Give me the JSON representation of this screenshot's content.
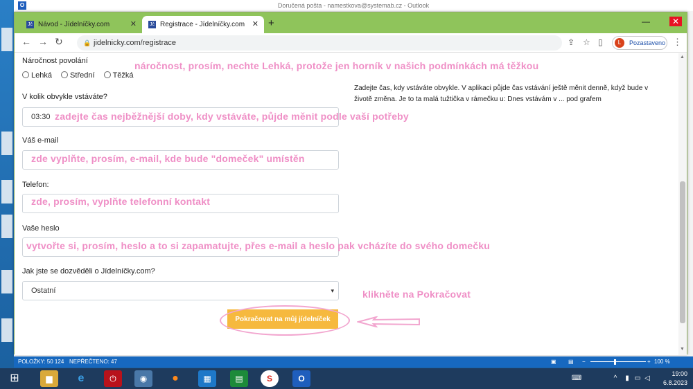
{
  "outlook": {
    "title": "Doručená pošta - namestkova@systemab.cz - Outlook",
    "status_items": "POLOŽKY: 50 124",
    "status_unread": "NEPŘEČTENO: 47",
    "zoom": "100 %"
  },
  "browser": {
    "tabs": [
      {
        "label": "Návod - Jídelníčky.com"
      },
      {
        "label": "Registrace - Jídelníčky.com"
      }
    ],
    "url": "jidelnicky.com/registrace",
    "profile_label": "Pozastaveno",
    "profile_initial": "L"
  },
  "form": {
    "difficulty_label": "Náročnost povolání",
    "difficulty_options": [
      "Lehká",
      "Střední",
      "Těžká"
    ],
    "wake_label": "V kolik obvykle vstáváte?",
    "wake_value": "03:30",
    "email_label": "Váš e-mail",
    "phone_label": "Telefon:",
    "password_label": "Vaše heslo",
    "source_label": "Jak jste se dozvěděli o Jídelníčky.com?",
    "source_value": "Ostatní",
    "submit_label": "Pokračovat na můj jídelníček"
  },
  "help_text": "Zadejte čas, kdy vstáváte obvykle. V aplikaci půjde čas vstávání ještě měnit denně, když bude v životě změna. Je to ta malá tužtička v rámečku u: Dnes vstávám v ...  pod grafem",
  "annotations": {
    "difficulty": "náročnost, prosím, nechte Lehká, protože jen horník v našich podmínkách má těžkou",
    "wake": "zadejte čas nejběžnější doby, kdy vstáváte, půjde měnit podle vaší potřeby",
    "email": "zde vyplňte, prosím, e-mail, kde bude \"domeček\" umístěn",
    "phone": "zde, prosím, vyplňte telefonní kontakt",
    "password": "vytvořte si, prosím, heslo a to si zapamatujte, přes e-mail a heslo pak vcházíte do svého domečku",
    "click": "klikněte na Pokračovat"
  },
  "taskbar": {
    "time": "19:00",
    "date": "6.8.2023"
  },
  "colors": {
    "tabbar": "#8fc45b",
    "annotation": "#ef8fc6",
    "submit": "#f6b93e",
    "outlook_status": "#1768bf"
  }
}
